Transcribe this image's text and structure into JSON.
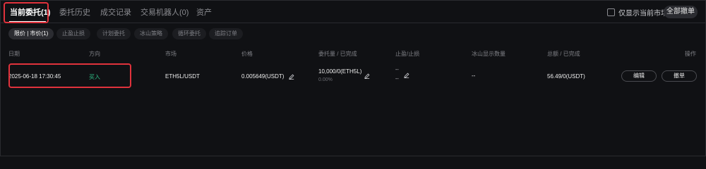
{
  "tabs": [
    {
      "label": "当前委托(1)"
    },
    {
      "label": "委托历史"
    },
    {
      "label": "成交记录"
    },
    {
      "label": "交易机器人(0)"
    },
    {
      "label": "资产"
    }
  ],
  "toolbar": {
    "only_current_market": "仅显示当前市场",
    "cancel_all": "全部撤单"
  },
  "filters": [
    {
      "label": "限价 | 市价(1)"
    },
    {
      "label": "止盈止损"
    },
    {
      "label": "计划委托"
    },
    {
      "label": "冰山策略"
    },
    {
      "label": "循环委托"
    },
    {
      "label": "追踪订单"
    }
  ],
  "columns": {
    "date": "日期",
    "side": "方向",
    "market": "市场",
    "price": "价格",
    "amount_filled": "委托量 / 已完成",
    "tp_sl": "止盈/止损",
    "iceberg_qty": "冰山显示数量",
    "total_filled": "总额 / 已完成",
    "action": "操作"
  },
  "order": {
    "date": "2025-06-18 17:30:45",
    "side": "买入",
    "market": "ETH5L/USDT",
    "price": "0.005649(USDT)",
    "amount_filled": "10,000/0(ETH5L)",
    "filled_pct": "0.00%",
    "tp": "--",
    "sl": "--",
    "iceberg_qty": "--",
    "total_filled": "56.49/0(USDT)",
    "edit_label": "编辑",
    "cancel_label": "撤单"
  },
  "colors": {
    "buy": "#2ebd85",
    "highlight": "#e0323c",
    "background": "#101114"
  },
  "icons": {
    "edit": "pencil-icon"
  }
}
